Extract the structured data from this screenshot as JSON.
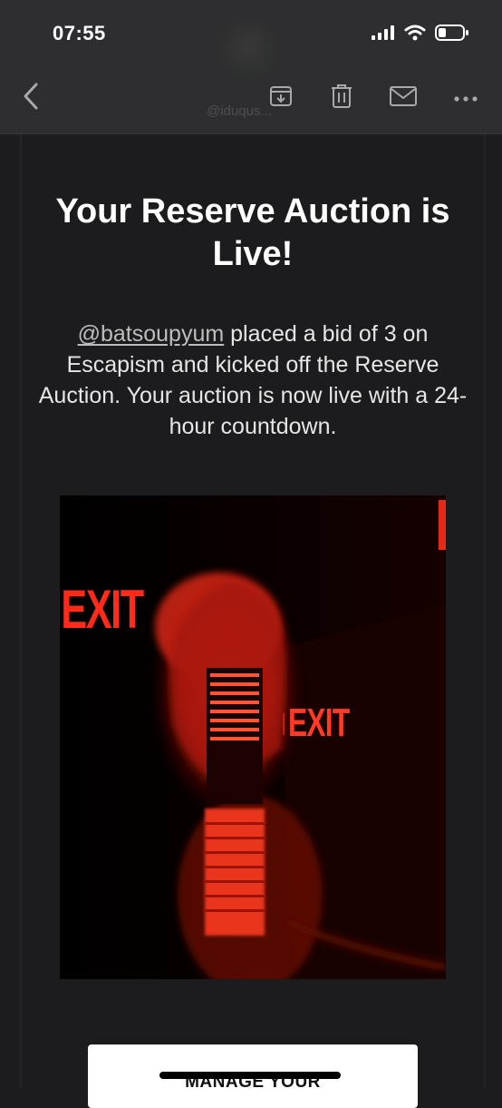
{
  "status_bar": {
    "time": "07:55"
  },
  "header": {
    "sender_handle": "@iduqus..."
  },
  "email": {
    "title": "Your Reserve Auction is Live!",
    "mention": "@batsoupyum",
    "body": "placed a bid of 3 on Escapism and kicked off the Reserve Auction. Your auction is now live with a 24-hour countdown.",
    "artwork": {
      "sign_left": "EXIT",
      "sign_right": "EXIT"
    },
    "cta_label": "MANAGE YOUR"
  },
  "icons": {
    "back": "chevron-left-icon",
    "archive": "archive-icon",
    "trash": "trash-icon",
    "mail": "envelope-icon",
    "more": "ellipsis-icon"
  },
  "colors": {
    "background": "#1c1c1e",
    "toolbar": "#2e2e30",
    "icon": "#a9a9ad",
    "accent_red": "#ff2a1a"
  }
}
